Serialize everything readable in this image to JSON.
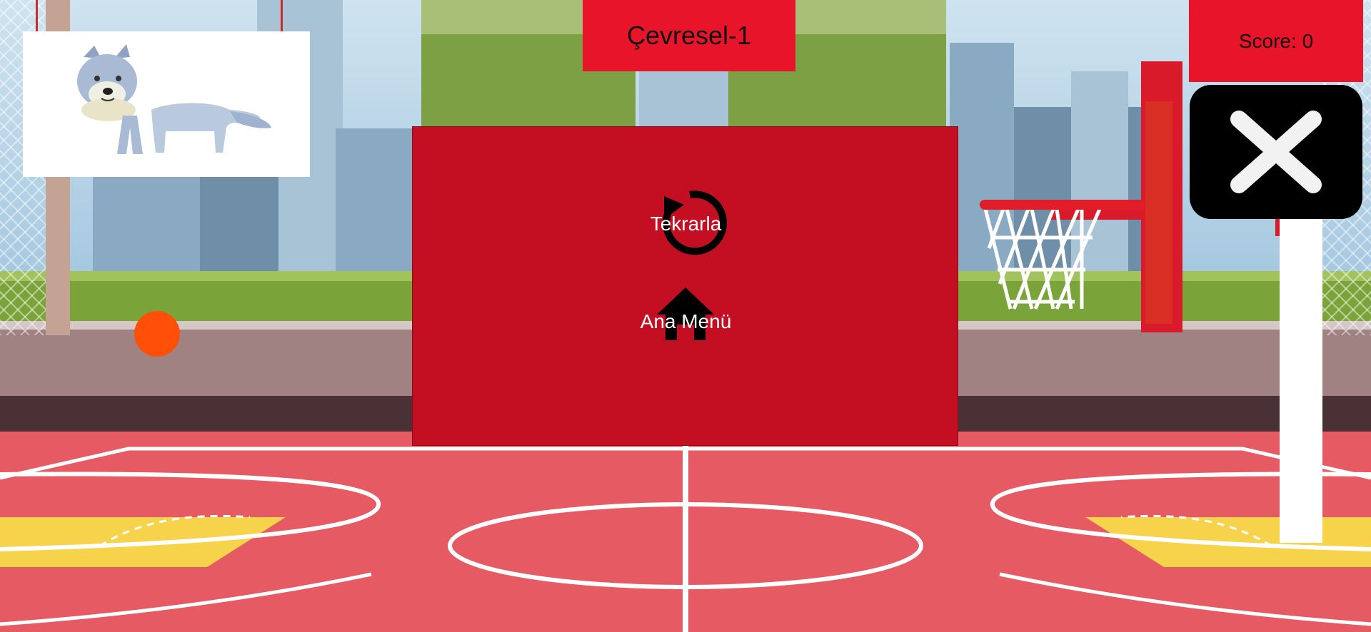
{
  "hud": {
    "level_title": "Çevresel-1",
    "score_label": "Score: 0"
  },
  "pause_menu": {
    "retry_label": "Tekrarla",
    "main_menu_label": "Ana Menü"
  },
  "icons": {
    "close": "close-icon",
    "retry": "refresh-icon",
    "home": "home-icon"
  },
  "colors": {
    "panel": "#c40f22",
    "hud_box": "#e8142a",
    "ball": "#ff4f08",
    "court": "#e55a63"
  }
}
